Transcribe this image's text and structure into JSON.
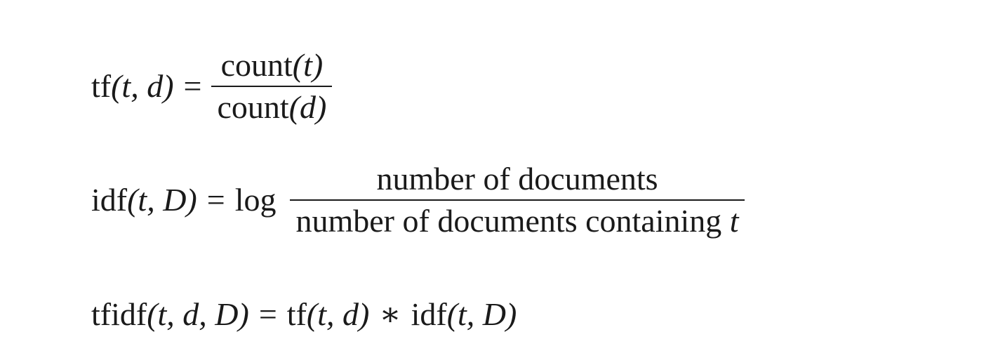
{
  "equations": {
    "tf": {
      "lhs_fn": "tf",
      "lhs_args": "(t, d)",
      "equals": "=",
      "numerator_fn": "count",
      "numerator_arg": "(t)",
      "denominator_fn": "count",
      "denominator_arg": "(d)"
    },
    "idf": {
      "lhs_fn": "idf",
      "lhs_args": "(t, D)",
      "equals": "=",
      "log": "log",
      "numerator": "number of documents",
      "denominator_text": "number of documents containing",
      "denominator_var": "t"
    },
    "tfidf": {
      "lhs_fn": "tfidf",
      "lhs_args": "(t, d, D)",
      "equals": "=",
      "term1_fn": "tf",
      "term1_args": "(t, d)",
      "times": "∗",
      "term2_fn": "idf",
      "term2_args": "(t, D)"
    }
  }
}
